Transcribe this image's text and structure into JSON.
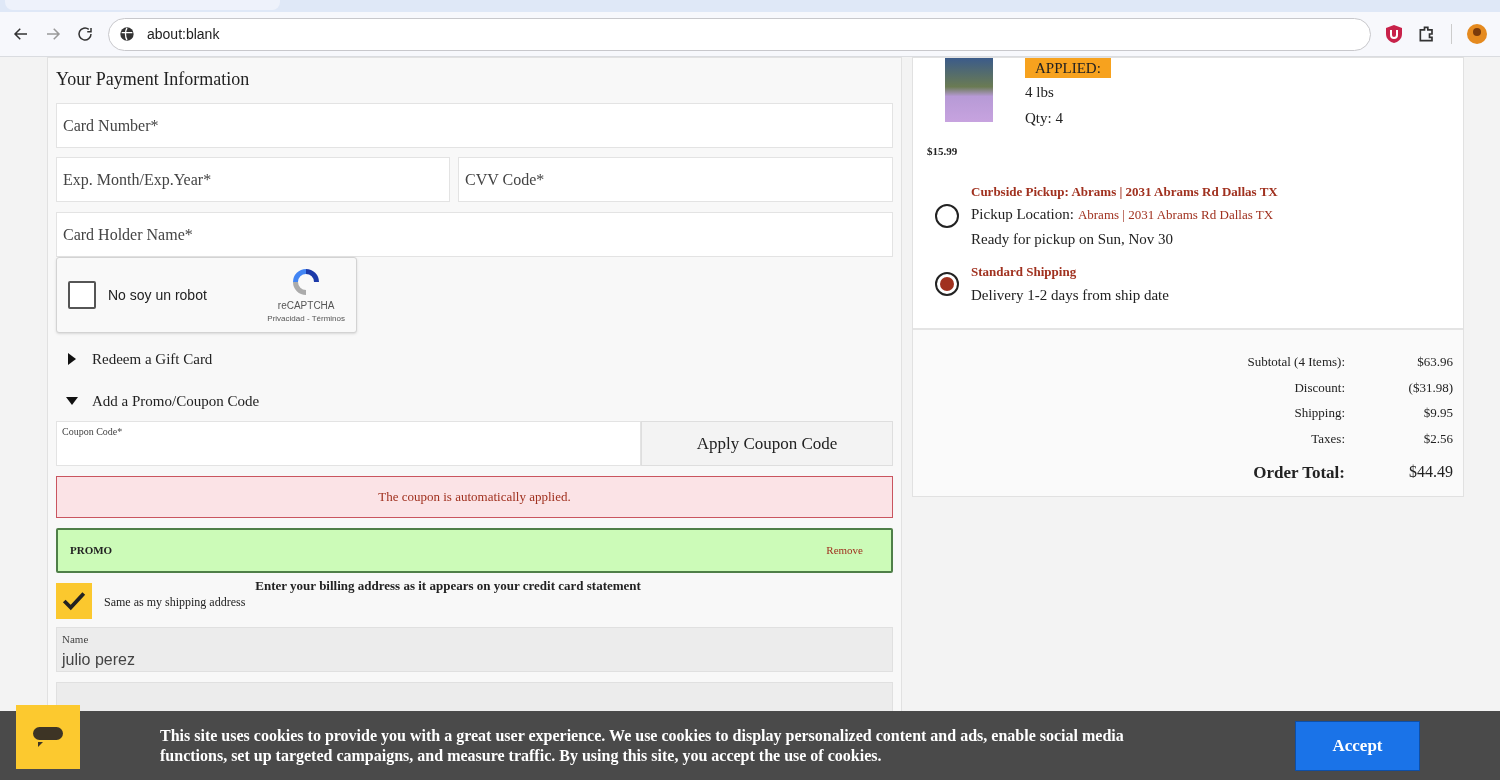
{
  "browser": {
    "address": "about:blank"
  },
  "payment": {
    "title": "Your Payment Information",
    "fields": [
      {
        "placeholder": "Card Number*"
      },
      {
        "placeholder": "Exp. Month/Exp.Year*"
      },
      {
        "placeholder": "CVV Code*"
      },
      {
        "placeholder": "Card Holder Name*"
      }
    ],
    "captcha": {
      "label": "No soy un robot",
      "checked": false,
      "brand": "reCAPTCHA",
      "links": "Privacidad - Términos"
    },
    "sections": [
      {
        "label": "Redeem a Gift Card",
        "expanded": false
      },
      {
        "label": "Add a Promo/Coupon Code",
        "expanded": true
      }
    ],
    "coupon": {
      "label": "Coupon Code*",
      "button": "Apply Coupon Code"
    },
    "alert": "The coupon is automatically applied.",
    "promo": {
      "code": "PROMO",
      "action": "Remove"
    },
    "billing": {
      "instruction": "Enter your billing address as it appears on your credit card statement",
      "same_as_shipping": {
        "label": "Same as my shipping address",
        "checked": true
      },
      "fields": [
        {
          "label": "Name",
          "value": "julio perez"
        }
      ]
    }
  },
  "order": {
    "item": {
      "badge": "APPLIED:",
      "size": "4 lbs",
      "qty": "Qty: 4",
      "price": "$15.99"
    },
    "delivery_options": [
      {
        "title": "Curbside Pickup: Abrams | 2031 Abrams Rd Dallas TX",
        "location_label": "Pickup Location:",
        "location": "Abrams | 2031 Abrams Rd Dallas TX",
        "note": "Ready for pickup on Sun, Nov 30",
        "selected": false
      },
      {
        "title": "Standard Shipping",
        "note": "Delivery 1-2 days from ship date",
        "selected": true
      }
    ],
    "totals": [
      {
        "label": "Subtotal (4 Items):",
        "value": "$63.96",
        "kind": "line"
      },
      {
        "label": "Discount:",
        "value": "($31.98)",
        "kind": "line"
      },
      {
        "label": "Shipping:",
        "value": "$9.95",
        "kind": "line"
      },
      {
        "label": "Taxes:",
        "value": "$2.56",
        "kind": "line"
      },
      {
        "label": "Order Total:",
        "value": "$44.49",
        "kind": "total"
      }
    ]
  },
  "cookie": {
    "text": "This site uses cookies to provide you with a great user experience. We use cookies to display personalized content and ads, enable social media functions, set up targeted campaigns, and measure traffic. By using this site, you accept the use of cookies.",
    "button": "Accept"
  }
}
